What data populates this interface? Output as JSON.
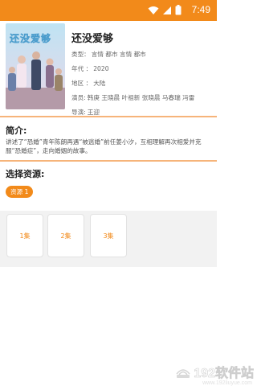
{
  "status_bar": {
    "time": "7:49"
  },
  "drama": {
    "title": "还没爱够",
    "poster_title": "还没爱够",
    "genre_label": "类型：",
    "genre_value": "言情 都市 言情 都市",
    "year_label": "年代 ：",
    "year_value": "2020",
    "region_label": "地区 ：",
    "region_value": "大陆",
    "cast_label": "演员:",
    "cast_value": "韩庚 王晓晨 叶祖新 张晓晨 马春瑞 冯雷",
    "director_label": "导演:",
    "director_value": "王迎"
  },
  "intro": {
    "heading": "简介:",
    "text": "讲述了“恐婚”青年陈朗再遇“被逃婚”前任姜小汐，互相理解再次相爱并克服“恐婚症”，走向婚姻的故事。"
  },
  "sources": {
    "heading": "选择资源:",
    "items": [
      {
        "label": "资源 1"
      }
    ]
  },
  "episodes": [
    {
      "label": "1集"
    },
    {
      "label": "2集"
    },
    {
      "label": "3集"
    }
  ],
  "watermark": {
    "text": "192软件站",
    "url": "www.192liuyue.com"
  },
  "colors": {
    "accent": "#f28a1a",
    "divider": "#f6b47a",
    "episode_bg": "#f2f2f2"
  }
}
